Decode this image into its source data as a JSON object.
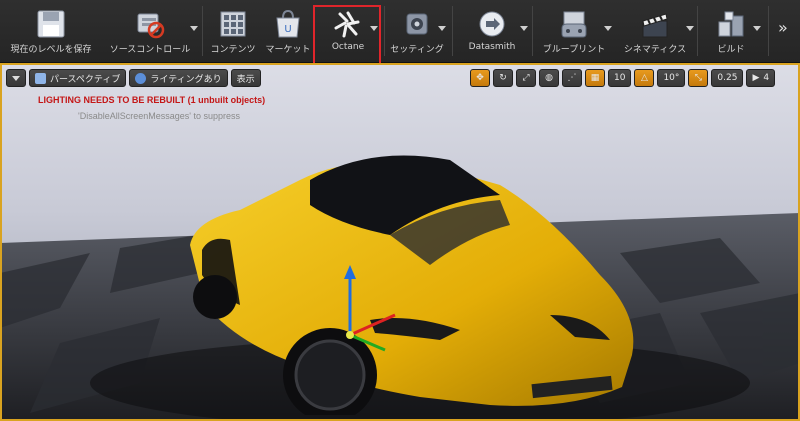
{
  "toolbar": {
    "items": [
      {
        "label": "現在のレベルを保存",
        "icon": "save-icon"
      },
      {
        "label": "ソースコントロール",
        "icon": "source-control-icon"
      },
      {
        "label": "コンテンツ",
        "icon": "content-grid-icon"
      },
      {
        "label": "マーケット",
        "icon": "marketplace-icon"
      },
      {
        "label": "Octane",
        "icon": "octane-logo-icon"
      },
      {
        "label": "セッティング",
        "icon": "settings-gear-icon"
      },
      {
        "label": "Datasmith",
        "icon": "datasmith-icon"
      },
      {
        "label": "ブループリント",
        "icon": "blueprint-gamepad-icon"
      },
      {
        "label": "シネマティクス",
        "icon": "clapperboard-icon"
      },
      {
        "label": "ビルド",
        "icon": "build-icon"
      }
    ],
    "overflow": "»"
  },
  "viewport": {
    "perspective_label": "パースペクティブ",
    "lighting_label": "ライティングあり",
    "show_label": "表示",
    "grid_snap": "10",
    "rotation_snap": "10°",
    "scale_snap": "0.25",
    "camera_speed": "4",
    "warning": "LIGHTING NEEDS TO BE REBUILT (1 unbuilt objects)",
    "suppress_hint": "'DisableAllScreenMessages' to suppress"
  },
  "colors": {
    "highlight": "#e0252b",
    "car_body": "#e8b40a",
    "accent": "#e89a1e"
  }
}
